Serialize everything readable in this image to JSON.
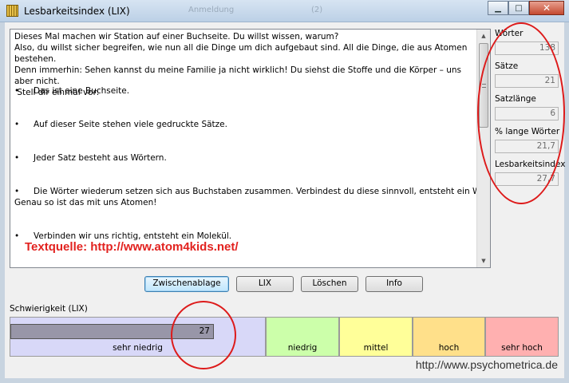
{
  "window": {
    "title": "Lesbarkeitsindex (LIX)",
    "ghost_text_1": "Anmeldung",
    "ghost_text_2": "(2)",
    "minimize": "▁",
    "maximize": "□",
    "close": "✕"
  },
  "text": {
    "intro": "Dieses Mal machen wir Station auf einer Buchseite. Du willst wissen, warum?\nAlso, du willst sicher begreifen, wie nun all die Dinge um dich aufgebaut sind. All die Dinge, die aus Atomen bestehen.\nDenn immerhin: Sehen kannst du meine Familie ja nicht wirklich! Du siehst die Stoffe und die Körper – uns aber nicht.\n Stell dir einmal vor:",
    "bullets": [
      "Das ist eine Buchseite.",
      "Auf dieser Seite stehen viele gedruckte Sätze.",
      "Jeder Satz besteht aus Wörtern.",
      "Die Wörter wiederum setzen sich aus  Buchstaben zusammen. Verbindest du diese sinnvoll, entsteht ein Wort.",
      "Verbinden wir uns richtig, entsteht ein Molekül."
    ],
    "bullet_continuation": "Genau so ist das mit uns Atomen!",
    "bullet_symbol": "•",
    "source": "Textquelle: http://www.atom4kids.net/"
  },
  "stats": {
    "words_label": "Wörter",
    "words_value": "138",
    "sentences_label": "Sätze",
    "sentences_value": "21",
    "sentence_length_label": "Satzlänge",
    "sentence_length_value": "6",
    "long_words_label": "% lange Wörter",
    "long_words_value": "21,7",
    "lix_label": "Lesbarkeitsindex",
    "lix_value": "27,7"
  },
  "buttons": {
    "clipboard": "Zwischenablage",
    "lix": "LIX",
    "clear": "Löschen",
    "info": "Info"
  },
  "difficulty": {
    "label": "Schwierigkeit (LIX)",
    "value": "27",
    "bands": [
      {
        "label": "sehr niedrig",
        "color": "#d8d8f8"
      },
      {
        "label": "niedrig",
        "color": "#ccffaa"
      },
      {
        "label": "mittel",
        "color": "#ffff99"
      },
      {
        "label": "hoch",
        "color": "#ffe08a"
      },
      {
        "label": "sehr hoch",
        "color": "#ffb0b0"
      }
    ]
  },
  "website": "http://www.psychometrica.de",
  "colors": {
    "annotation": "#dd1a1a",
    "source_text": "#e2221f",
    "progress": "#9896a8"
  }
}
